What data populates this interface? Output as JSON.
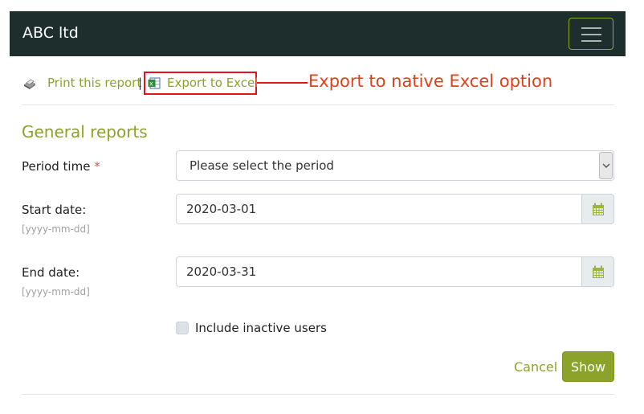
{
  "navbar": {
    "brand": "ABC ltd",
    "menu_icon": "hamburger-icon"
  },
  "toolbar": {
    "print_icon": "printer-icon",
    "print_label": "Print this report",
    "separator": "|",
    "export_icon": "excel-icon",
    "export_label": "Export to Excel"
  },
  "annotation": {
    "text": "Export to native Excel option",
    "color": "#e0141c"
  },
  "form": {
    "title": "General reports",
    "period": {
      "label": "Period time",
      "required_mark": "*",
      "selected": "Please select the period"
    },
    "start_date": {
      "label": "Start date:",
      "hint": "[yyyy-mm-dd]",
      "value": "2020-03-01",
      "icon": "calendar-icon"
    },
    "end_date": {
      "label": "End date:",
      "hint": "[yyyy-mm-dd]",
      "value": "2020-03-31",
      "icon": "calendar-icon"
    },
    "include_inactive": {
      "label": "Include inactive users",
      "checked": false
    },
    "cancel_label": "Cancel",
    "show_label": "Show"
  },
  "colors": {
    "accent": "#8ba32b",
    "navbar_bg": "#1e2e2d",
    "annotation": "#e0141c"
  }
}
